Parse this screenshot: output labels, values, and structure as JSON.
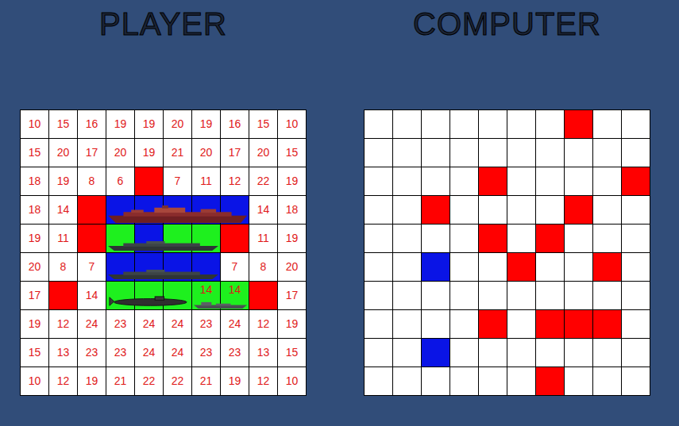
{
  "titles": {
    "player": "PLAYER",
    "computer": "COMPUTER"
  },
  "player_grid": {
    "rows": [
      [
        {
          "kind": "number",
          "text": "10"
        },
        {
          "kind": "number",
          "text": "15"
        },
        {
          "kind": "number",
          "text": "16"
        },
        {
          "kind": "number",
          "text": "19"
        },
        {
          "kind": "number",
          "text": "19"
        },
        {
          "kind": "number",
          "text": "20"
        },
        {
          "kind": "number",
          "text": "19"
        },
        {
          "kind": "number",
          "text": "16"
        },
        {
          "kind": "number",
          "text": "15"
        },
        {
          "kind": "number",
          "text": "10"
        }
      ],
      [
        {
          "kind": "number",
          "text": "15"
        },
        {
          "kind": "number",
          "text": "20"
        },
        {
          "kind": "number",
          "text": "17"
        },
        {
          "kind": "number",
          "text": "20"
        },
        {
          "kind": "number",
          "text": "19"
        },
        {
          "kind": "number",
          "text": "21"
        },
        {
          "kind": "number",
          "text": "20"
        },
        {
          "kind": "number",
          "text": "17"
        },
        {
          "kind": "number",
          "text": "20"
        },
        {
          "kind": "number",
          "text": "15"
        }
      ],
      [
        {
          "kind": "number",
          "text": "18"
        },
        {
          "kind": "number",
          "text": "19"
        },
        {
          "kind": "number",
          "text": "8"
        },
        {
          "kind": "number",
          "text": "6"
        },
        {
          "kind": "hit"
        },
        {
          "kind": "number",
          "text": "7"
        },
        {
          "kind": "number",
          "text": "11"
        },
        {
          "kind": "number",
          "text": "12"
        },
        {
          "kind": "number",
          "text": "22"
        },
        {
          "kind": "number",
          "text": "19"
        }
      ],
      [
        {
          "kind": "number",
          "text": "18"
        },
        {
          "kind": "number",
          "text": "14"
        },
        {
          "kind": "hit"
        },
        {
          "kind": "ship",
          "color": "#0a14e6"
        },
        {
          "kind": "ship",
          "color": "#0a14e6"
        },
        {
          "kind": "ship",
          "color": "#0a14e6"
        },
        {
          "kind": "ship",
          "color": "#0a14e6"
        },
        {
          "kind": "ship",
          "color": "#0a14e6"
        },
        {
          "kind": "number",
          "text": "14"
        },
        {
          "kind": "number",
          "text": "18"
        }
      ],
      [
        {
          "kind": "number",
          "text": "19"
        },
        {
          "kind": "number",
          "text": "11"
        },
        {
          "kind": "hit"
        },
        {
          "kind": "ship",
          "color": "#1ef01e"
        },
        {
          "kind": "ship",
          "color": "#0a14e6"
        },
        {
          "kind": "ship",
          "color": "#1ef01e"
        },
        {
          "kind": "ship",
          "color": "#1ef01e"
        },
        {
          "kind": "hit"
        },
        {
          "kind": "number",
          "text": "11"
        },
        {
          "kind": "number",
          "text": "19"
        }
      ],
      [
        {
          "kind": "number",
          "text": "20"
        },
        {
          "kind": "number",
          "text": "8"
        },
        {
          "kind": "number",
          "text": "7"
        },
        {
          "kind": "ship",
          "color": "#0a14e6"
        },
        {
          "kind": "ship",
          "color": "#0a14e6"
        },
        {
          "kind": "ship",
          "color": "#0a14e6"
        },
        {
          "kind": "ship",
          "color": "#0a14e6"
        },
        {
          "kind": "number",
          "text": "7"
        },
        {
          "kind": "number",
          "text": "8"
        },
        {
          "kind": "number",
          "text": "20"
        }
      ],
      [
        {
          "kind": "number",
          "text": "17"
        },
        {
          "kind": "hit"
        },
        {
          "kind": "number",
          "text": "14"
        },
        {
          "kind": "ship",
          "color": "#1ef01e"
        },
        {
          "kind": "ship",
          "color": "#1ef01e"
        },
        {
          "kind": "ship",
          "color": "#1ef01e"
        },
        {
          "kind": "ship",
          "color": "#1ef01e",
          "text": "14"
        },
        {
          "kind": "ship",
          "color": "#1ef01e",
          "text": "14"
        },
        {
          "kind": "hit"
        },
        {
          "kind": "number",
          "text": "17"
        }
      ],
      [
        {
          "kind": "number",
          "text": "19"
        },
        {
          "kind": "number",
          "text": "12"
        },
        {
          "kind": "number",
          "text": "24"
        },
        {
          "kind": "number",
          "text": "23"
        },
        {
          "kind": "number",
          "text": "24"
        },
        {
          "kind": "number",
          "text": "24"
        },
        {
          "kind": "number",
          "text": "23"
        },
        {
          "kind": "number",
          "text": "24"
        },
        {
          "kind": "number",
          "text": "12"
        },
        {
          "kind": "number",
          "text": "19"
        }
      ],
      [
        {
          "kind": "number",
          "text": "15"
        },
        {
          "kind": "number",
          "text": "13"
        },
        {
          "kind": "number",
          "text": "23"
        },
        {
          "kind": "number",
          "text": "23"
        },
        {
          "kind": "number",
          "text": "24"
        },
        {
          "kind": "number",
          "text": "24"
        },
        {
          "kind": "number",
          "text": "23"
        },
        {
          "kind": "number",
          "text": "23"
        },
        {
          "kind": "number",
          "text": "13"
        },
        {
          "kind": "number",
          "text": "15"
        }
      ],
      [
        {
          "kind": "number",
          "text": "10"
        },
        {
          "kind": "number",
          "text": "12"
        },
        {
          "kind": "number",
          "text": "19"
        },
        {
          "kind": "number",
          "text": "21"
        },
        {
          "kind": "number",
          "text": "22"
        },
        {
          "kind": "number",
          "text": "22"
        },
        {
          "kind": "number",
          "text": "21"
        },
        {
          "kind": "number",
          "text": "19"
        },
        {
          "kind": "number",
          "text": "12"
        },
        {
          "kind": "number",
          "text": "10"
        }
      ]
    ],
    "ships": [
      {
        "kind": "battleship",
        "row": 3,
        "col": 3,
        "length": 5
      },
      {
        "kind": "destroyer",
        "row": 4,
        "col": 3,
        "length": 4
      },
      {
        "kind": "cruiser",
        "row": 5,
        "col": 3,
        "length": 4
      },
      {
        "kind": "submarine",
        "row": 6,
        "col": 3,
        "length": 3
      },
      {
        "kind": "boat",
        "row": 6,
        "col": 6,
        "length": 2
      }
    ]
  },
  "computer_grid": {
    "rows": [
      [
        "water",
        "water",
        "water",
        "water",
        "water",
        "water",
        "water",
        "hit",
        "water",
        "water"
      ],
      [
        "water",
        "water",
        "water",
        "water",
        "water",
        "water",
        "water",
        "water",
        "water",
        "water"
      ],
      [
        "water",
        "water",
        "water",
        "water",
        "hit",
        "water",
        "water",
        "water",
        "water",
        "hit"
      ],
      [
        "water",
        "water",
        "hit",
        "water",
        "water",
        "water",
        "water",
        "hit",
        "water",
        "water"
      ],
      [
        "water",
        "water",
        "water",
        "water",
        "hit",
        "water",
        "hit",
        "water",
        "water",
        "water"
      ],
      [
        "water",
        "water",
        "miss",
        "water",
        "water",
        "hit",
        "water",
        "water",
        "hit",
        "water"
      ],
      [
        "water",
        "water",
        "water",
        "water",
        "water",
        "water",
        "water",
        "water",
        "water",
        "water"
      ],
      [
        "water",
        "water",
        "water",
        "water",
        "hit",
        "water",
        "hit",
        "hit",
        "hit",
        "water"
      ],
      [
        "water",
        "water",
        "miss",
        "water",
        "water",
        "water",
        "water",
        "water",
        "water",
        "water"
      ],
      [
        "water",
        "water",
        "water",
        "water",
        "water",
        "water",
        "hit",
        "water",
        "water",
        "water"
      ]
    ]
  }
}
